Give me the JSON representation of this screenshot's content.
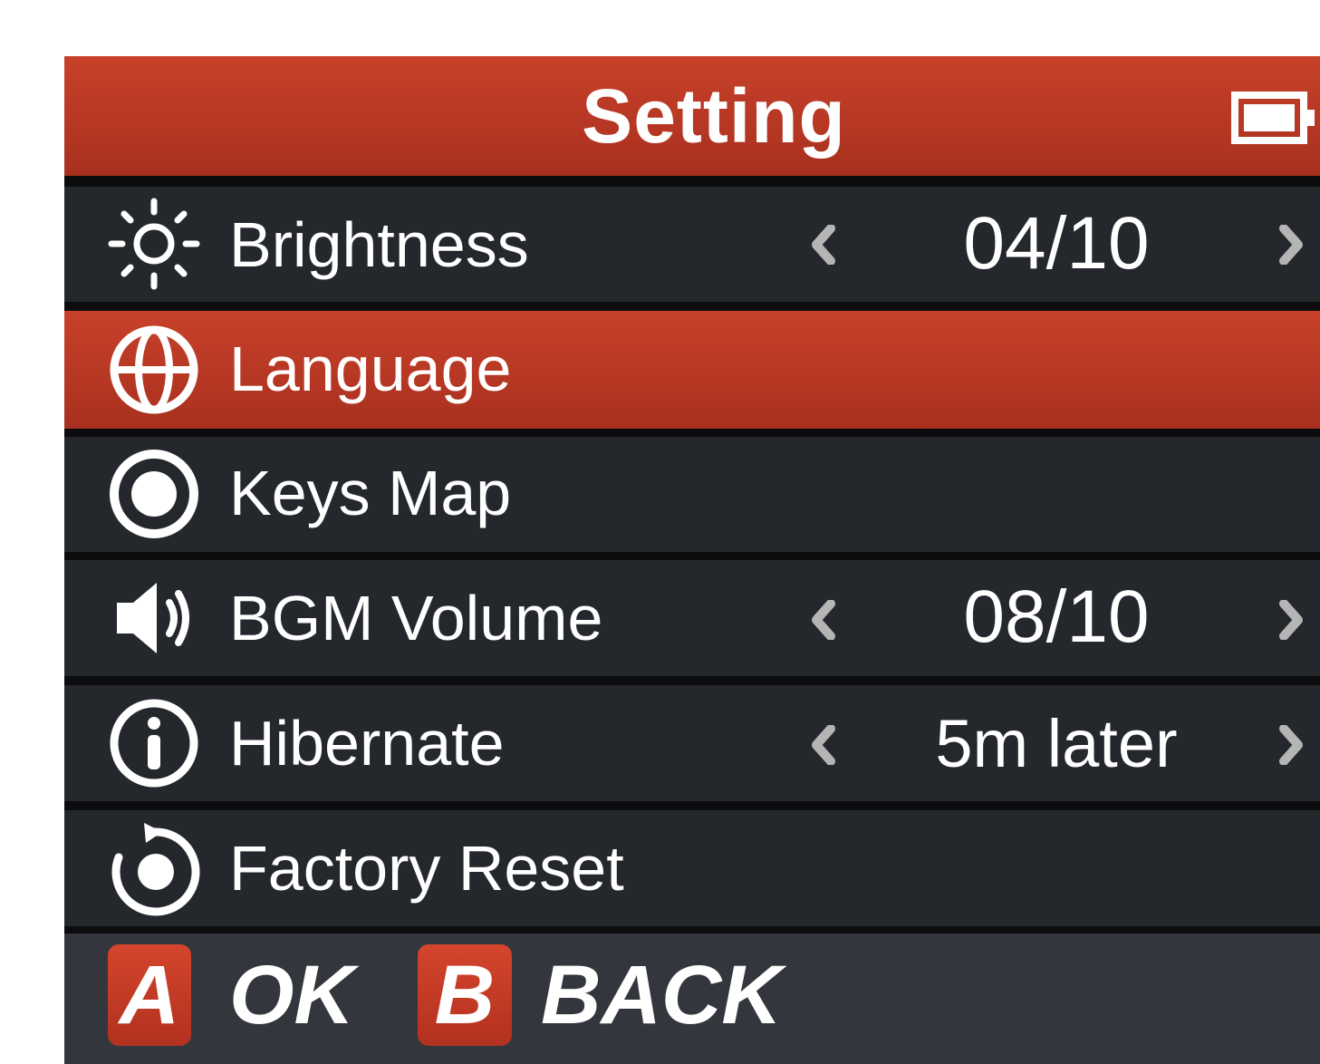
{
  "header": {
    "title": "Setting",
    "battery_icon": "battery-icon"
  },
  "menu": {
    "selected_index": 1,
    "items": [
      {
        "label": "Brightness",
        "icon": "sun-icon",
        "value": "04/10"
      },
      {
        "label": "Language",
        "icon": "globe-icon"
      },
      {
        "label": "Keys Map",
        "icon": "radio-button-icon"
      },
      {
        "label": "BGM Volume",
        "icon": "speaker-icon",
        "value": "08/10"
      },
      {
        "label": "Hibernate",
        "icon": "info-icon",
        "value": "5m later"
      },
      {
        "label": "Factory Reset",
        "icon": "reset-icon"
      }
    ]
  },
  "footer": {
    "a_key": "A",
    "a_label": "OK",
    "b_key": "B",
    "b_label": "BACK"
  },
  "colors": {
    "accent": "#c0392b",
    "row_background": "#24272c",
    "footer_background": "#33363d",
    "arrow": "#b5b5b5"
  }
}
